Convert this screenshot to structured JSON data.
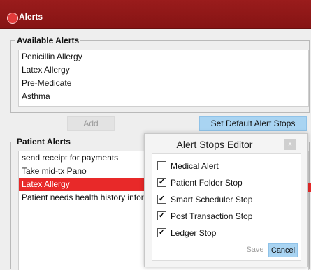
{
  "window": {
    "title": "Alerts"
  },
  "available_alerts": {
    "legend": "Available Alerts",
    "items": [
      "Penicillin Allergy",
      "Latex Allergy",
      "Pre-Medicate",
      "Asthma"
    ]
  },
  "buttons": {
    "add": "Add",
    "set_default": "Set Default Alert Stops"
  },
  "patient_alerts": {
    "legend": "Patient Alerts",
    "items": [
      "send receipt for payments",
      "Take mid-tx Pano",
      "Latex Allergy",
      "Patient needs health history inform"
    ],
    "selected_index": 2
  },
  "dialog": {
    "title": "Alert Stops Editor",
    "close": "x",
    "options": [
      {
        "label": "Medical Alert",
        "checked": false
      },
      {
        "label": "Patient Folder Stop",
        "checked": true
      },
      {
        "label": "Smart Scheduler Stop",
        "checked": true
      },
      {
        "label": "Post Transaction Stop",
        "checked": true
      },
      {
        "label": "Ledger Stop",
        "checked": true
      }
    ],
    "save": "Save",
    "cancel": "Cancel"
  },
  "colors": {
    "titlebar": "#8e1717",
    "selection": "#e82929",
    "accent_button": "#a9d4f2"
  }
}
